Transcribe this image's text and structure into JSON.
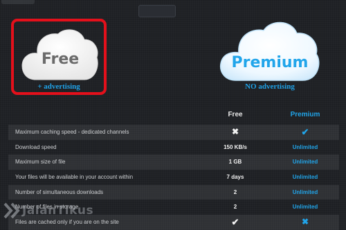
{
  "plans": {
    "free": {
      "label": "Free",
      "subtitle": "+ advertising"
    },
    "premium": {
      "label": "Premium",
      "subtitle": "NO advertising"
    }
  },
  "table": {
    "headers": {
      "free": "Free",
      "premium": "Premium"
    },
    "rows": [
      {
        "feature": "Maximum caching speed - dedicated channels",
        "free": "✖",
        "premium": "✔"
      },
      {
        "feature": "Download speed",
        "free": "150 KB/s",
        "premium": "Unlimited"
      },
      {
        "feature": "Maximum size of file",
        "free": "1 GB",
        "premium": "Unlimited"
      },
      {
        "feature": "Your files will be available in your account within",
        "free": "7 days",
        "premium": "Unlimited"
      },
      {
        "feature": "Number of simultaneous downloads",
        "free": "2",
        "premium": "Unlimited"
      },
      {
        "feature": "Number of files in storage",
        "free": "2",
        "premium": "Unlimited"
      },
      {
        "feature": "Files are cached only if you are on the site",
        "free": "✔",
        "premium": "✖"
      }
    ]
  },
  "watermark": {
    "text": "JalanTikus"
  },
  "colors": {
    "accent": "#21a5ea",
    "highlight": "#e4101b",
    "background": "#202226"
  }
}
